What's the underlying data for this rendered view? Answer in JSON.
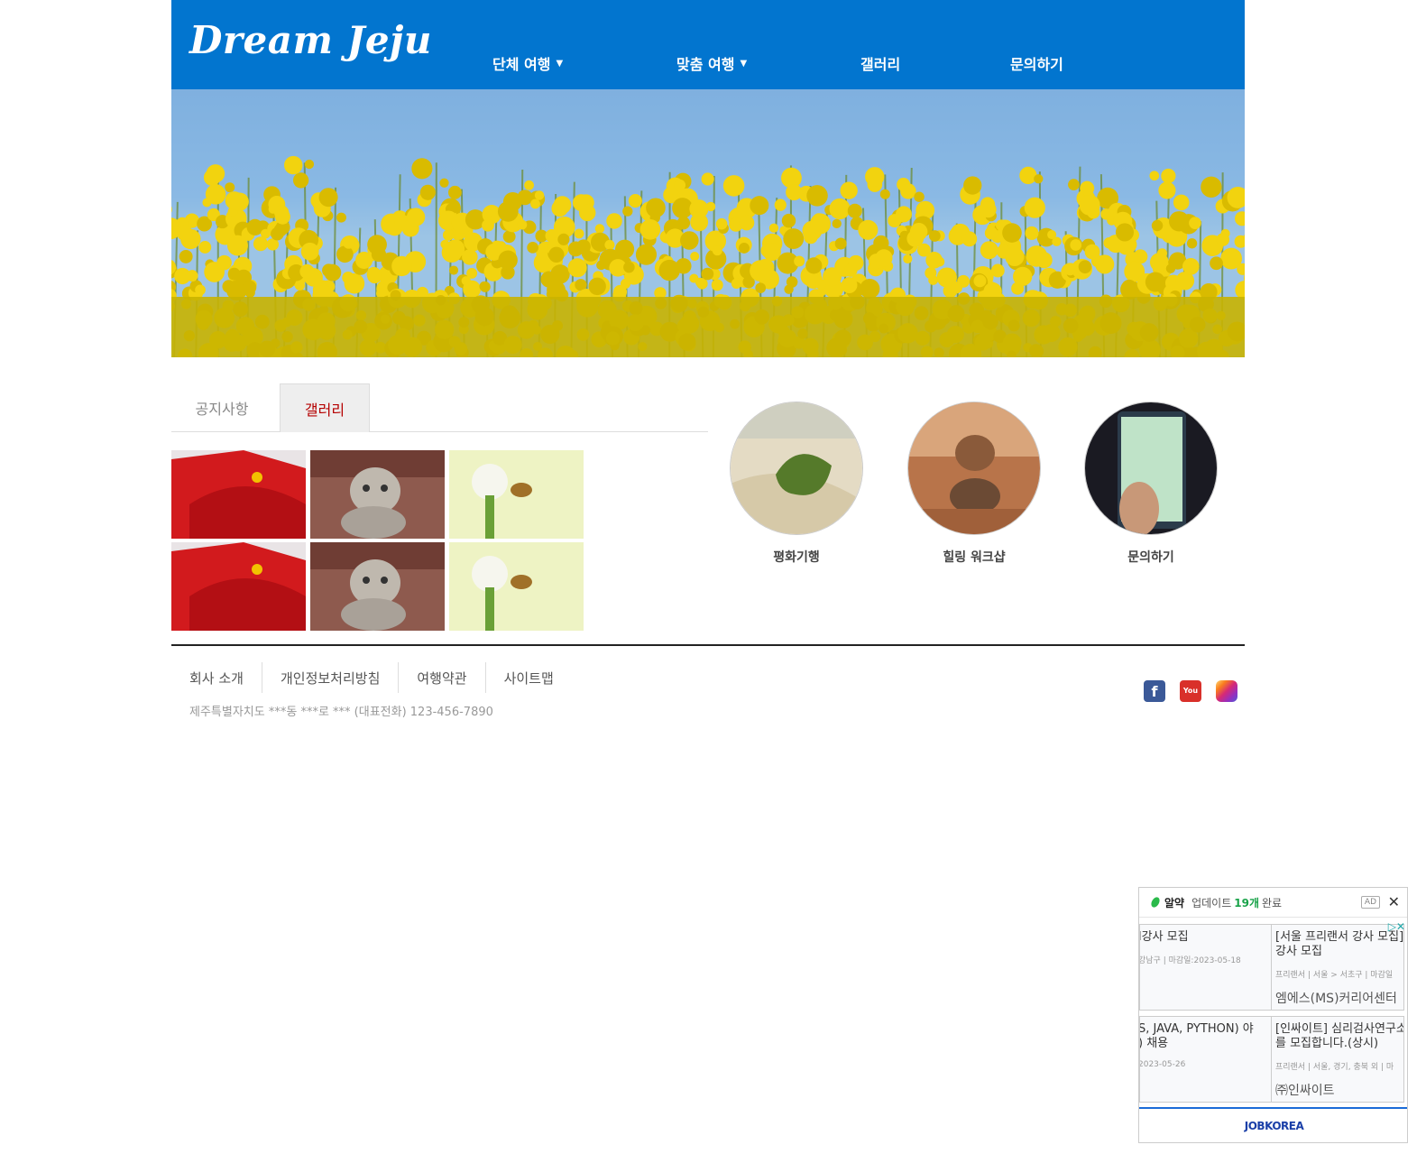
{
  "header": {
    "logo": "Dream Jeju",
    "nav": [
      {
        "label": "단체 여행",
        "has_dropdown": true
      },
      {
        "label": "맞춤 여행",
        "has_dropdown": true
      },
      {
        "label": "갤러리",
        "has_dropdown": false
      },
      {
        "label": "문의하기",
        "has_dropdown": false
      }
    ],
    "caret": "▼"
  },
  "tabs": [
    {
      "label": "공지사항",
      "active": false
    },
    {
      "label": "갤러리",
      "active": true
    }
  ],
  "gallery": [
    "flower-image",
    "cat-image",
    "bee-image",
    "flower-image",
    "cat-image",
    "bee-image"
  ],
  "circles": [
    {
      "label": "평화기행",
      "image": "leaf-on-sand"
    },
    {
      "label": "힐링 워크샵",
      "image": "stacked-stones"
    },
    {
      "label": "문의하기",
      "image": "phone-dialpad"
    }
  ],
  "footer": {
    "links": [
      "회사 소개",
      "개인정보처리방침",
      "여행약관",
      "사이트맵"
    ],
    "address": "제주특별자치도 ***동 ***로 *** (대표전화) 123-456-7890",
    "social": [
      "facebook-icon",
      "youtube-icon",
      "instagram-icon"
    ]
  },
  "ad": {
    "app_name": "알약",
    "update_text": "업데이트",
    "count": "19개",
    "done_text": "완료",
    "ad_tag": "AD",
    "close": "✕",
    "jobs": [
      {
        "title": "l강사 모집",
        "meta": "강남구 | 마감일:2023-05-18",
        "company": ""
      },
      {
        "title": "[서울 프리랜서 강사 모집]\n강사 모집",
        "meta": "프리랜서 | 서울 > 서초구 | 마감일",
        "company": "엠에스(MS)커리어센터"
      },
      {
        "title": "S, JAVA, PYTHON) 야\n) 채용",
        "meta": "2023-05-26",
        "company": ""
      },
      {
        "title": "[인싸이트] 심리검사연구소\n를 모집합니다.(상시)",
        "meta": "프리랜서 | 서울, 경기, 충북 외 | 마",
        "company": "㈜인싸이트"
      }
    ],
    "footer_brand": "JOBKOREA"
  },
  "colors": {
    "header_bg": "#0275cf",
    "active_tab": "#b50000"
  }
}
